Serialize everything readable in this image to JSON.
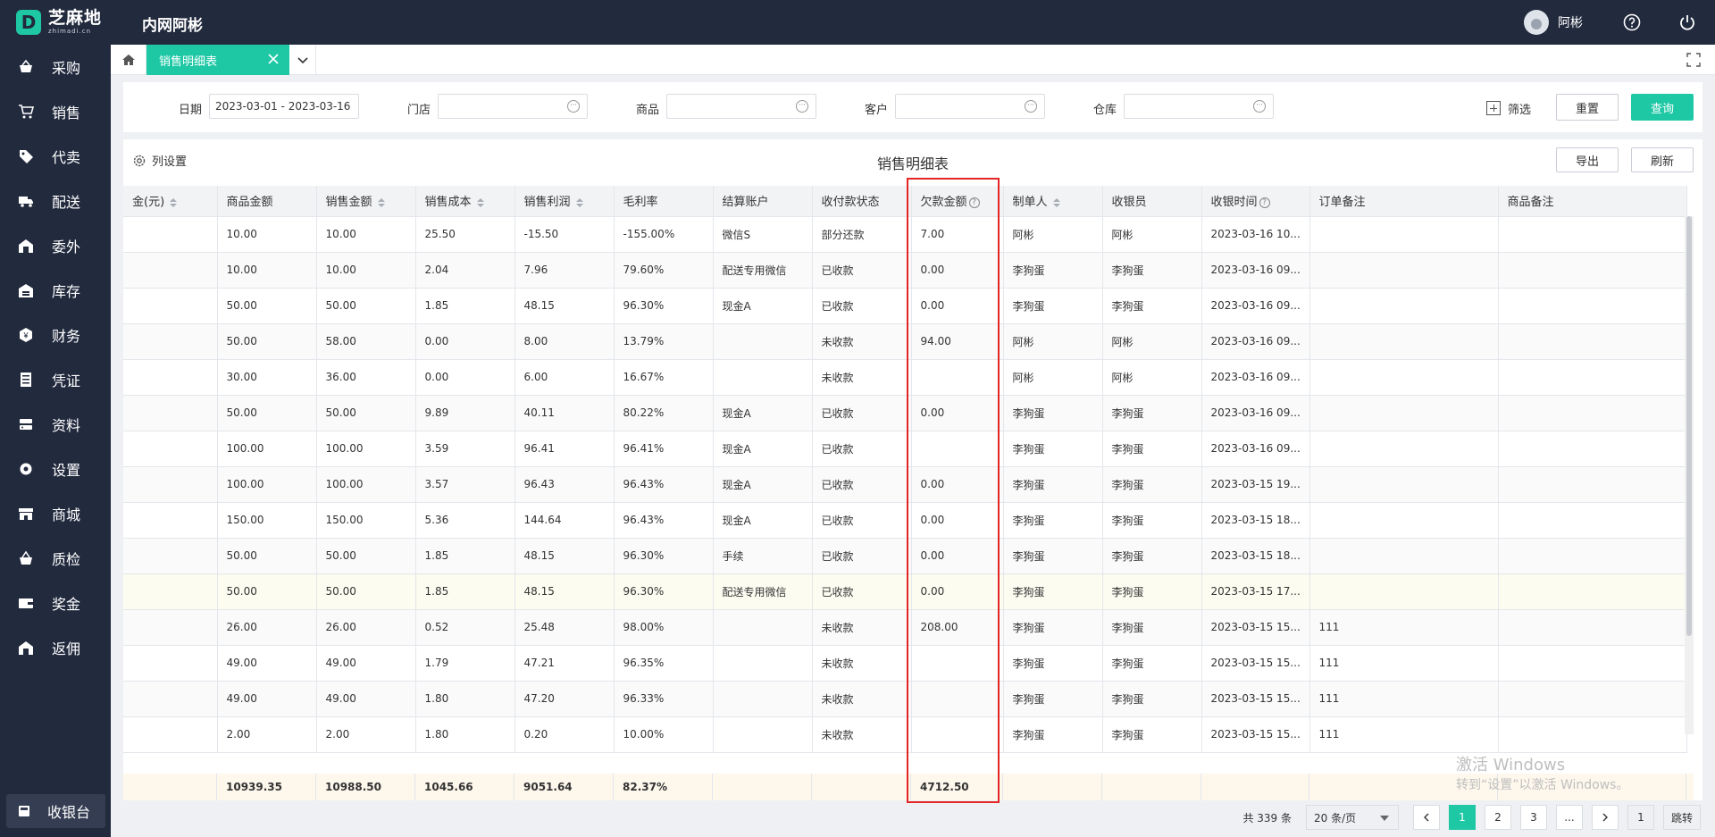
{
  "brand": {
    "name": "芝麻地",
    "sub": "zhimadi.cn",
    "mark": "D"
  },
  "app_title": "内网阿彬",
  "user": {
    "name": "阿彬"
  },
  "sidebar": {
    "items": [
      {
        "label": "采购",
        "icon": "basket-icon"
      },
      {
        "label": "销售",
        "icon": "cart-icon"
      },
      {
        "label": "代卖",
        "icon": "tag-icon"
      },
      {
        "label": "配送",
        "icon": "truck-icon"
      },
      {
        "label": "委外",
        "icon": "building-icon"
      },
      {
        "label": "库存",
        "icon": "warehouse-icon"
      },
      {
        "label": "财务",
        "icon": "coin-icon"
      },
      {
        "label": "凭证",
        "icon": "receipt-icon"
      },
      {
        "label": "资料",
        "icon": "database-icon"
      },
      {
        "label": "设置",
        "icon": "gear-icon"
      },
      {
        "label": "商城",
        "icon": "store-icon"
      },
      {
        "label": "质检",
        "icon": "inspect-icon"
      },
      {
        "label": "奖金",
        "icon": "wallet-icon"
      },
      {
        "label": "返佣",
        "icon": "rebate-icon"
      }
    ],
    "cashier": "收银台"
  },
  "tabs": {
    "active": "销售明细表"
  },
  "filters": {
    "date_label": "日期",
    "date_value": "2023-03-01 - 2023-03-16",
    "store_label": "门店",
    "goods_label": "商品",
    "customer_label": "客户",
    "warehouse_label": "仓库",
    "screen_label": "筛选",
    "reset_label": "重置",
    "query_label": "查询"
  },
  "main": {
    "colset_label": "列设置",
    "title": "销售明细表",
    "export_label": "导出",
    "refresh_label": "刷新"
  },
  "table": {
    "headers": [
      "金(元)",
      "商品金额",
      "销售金额",
      "销售成本",
      "销售利润",
      "毛利率",
      "结算账户",
      "收付款状态",
      "欠款金额",
      "制单人",
      "收银员",
      "收银时间",
      "订单备注",
      "商品备注"
    ],
    "rows": [
      [
        "",
        "10.00",
        "10.00",
        "25.50",
        "-15.50",
        "-155.00%",
        "微信S",
        "部分还款",
        "7.00",
        "阿彬",
        "阿彬",
        "2023-03-16 10...",
        "",
        ""
      ],
      [
        "",
        "10.00",
        "10.00",
        "2.04",
        "7.96",
        "79.60%",
        "配送专用微信",
        "已收款",
        "0.00",
        "李狗蛋",
        "李狗蛋",
        "2023-03-16 09...",
        "",
        ""
      ],
      [
        "",
        "50.00",
        "50.00",
        "1.85",
        "48.15",
        "96.30%",
        "现金A",
        "已收款",
        "0.00",
        "李狗蛋",
        "李狗蛋",
        "2023-03-16 09...",
        "",
        ""
      ],
      [
        "",
        "50.00",
        "58.00",
        "0.00",
        "8.00",
        "13.79%",
        "",
        "未收款",
        "94.00",
        "阿彬",
        "阿彬",
        "2023-03-16 09...",
        "",
        ""
      ],
      [
        "",
        "30.00",
        "36.00",
        "0.00",
        "6.00",
        "16.67%",
        "",
        "未收款",
        "",
        "阿彬",
        "阿彬",
        "2023-03-16 09...",
        "",
        ""
      ],
      [
        "",
        "50.00",
        "50.00",
        "9.89",
        "40.11",
        "80.22%",
        "现金A",
        "已收款",
        "0.00",
        "李狗蛋",
        "李狗蛋",
        "2023-03-16 09...",
        "",
        ""
      ],
      [
        "",
        "100.00",
        "100.00",
        "3.59",
        "96.41",
        "96.41%",
        "现金A",
        "已收款",
        "",
        "李狗蛋",
        "李狗蛋",
        "2023-03-16 09...",
        "",
        ""
      ],
      [
        "",
        "100.00",
        "100.00",
        "3.57",
        "96.43",
        "96.43%",
        "现金A",
        "已收款",
        "0.00",
        "李狗蛋",
        "李狗蛋",
        "2023-03-15 19...",
        "",
        ""
      ],
      [
        "",
        "150.00",
        "150.00",
        "5.36",
        "144.64",
        "96.43%",
        "现金A",
        "已收款",
        "0.00",
        "李狗蛋",
        "李狗蛋",
        "2023-03-15 18...",
        "",
        ""
      ],
      [
        "",
        "50.00",
        "50.00",
        "1.85",
        "48.15",
        "96.30%",
        "手续",
        "已收款",
        "0.00",
        "李狗蛋",
        "李狗蛋",
        "2023-03-15 18...",
        "",
        ""
      ],
      [
        "",
        "50.00",
        "50.00",
        "1.85",
        "48.15",
        "96.30%",
        "配送专用微信",
        "已收款",
        "0.00",
        "李狗蛋",
        "李狗蛋",
        "2023-03-15 17...",
        "",
        ""
      ],
      [
        "",
        "26.00",
        "26.00",
        "0.52",
        "25.48",
        "98.00%",
        "",
        "未收款",
        "208.00",
        "李狗蛋",
        "李狗蛋",
        "2023-03-15 15...",
        "111",
        ""
      ],
      [
        "",
        "49.00",
        "49.00",
        "1.79",
        "47.21",
        "96.35%",
        "",
        "未收款",
        "",
        "李狗蛋",
        "李狗蛋",
        "2023-03-15 15...",
        "111",
        ""
      ],
      [
        "",
        "49.00",
        "49.00",
        "1.80",
        "47.20",
        "96.33%",
        "",
        "未收款",
        "",
        "李狗蛋",
        "李狗蛋",
        "2023-03-15 15...",
        "111",
        ""
      ],
      [
        "",
        "2.00",
        "2.00",
        "1.80",
        "0.20",
        "10.00%",
        "",
        "未收款",
        "",
        "李狗蛋",
        "李狗蛋",
        "2023-03-15 15...",
        "111",
        ""
      ]
    ],
    "totals": [
      "",
      "10939.35",
      "10988.50",
      "1045.66",
      "9051.64",
      "82.37%",
      "",
      "",
      "4712.50",
      "",
      "",
      "",
      "",
      ""
    ]
  },
  "pager": {
    "total": "共 339 条",
    "page_size": "20 条/页",
    "pages": [
      "1",
      "2",
      "3",
      "..."
    ],
    "jump_value": "1",
    "jump_label": "跳转"
  },
  "watermark": {
    "line1": "激活 Windows",
    "line2": "转到“设置”以激活 Windows。"
  },
  "colors": {
    "accent": "#1ec8a5",
    "sidebar": "#222a3e",
    "highlight_box": "#e42525"
  }
}
